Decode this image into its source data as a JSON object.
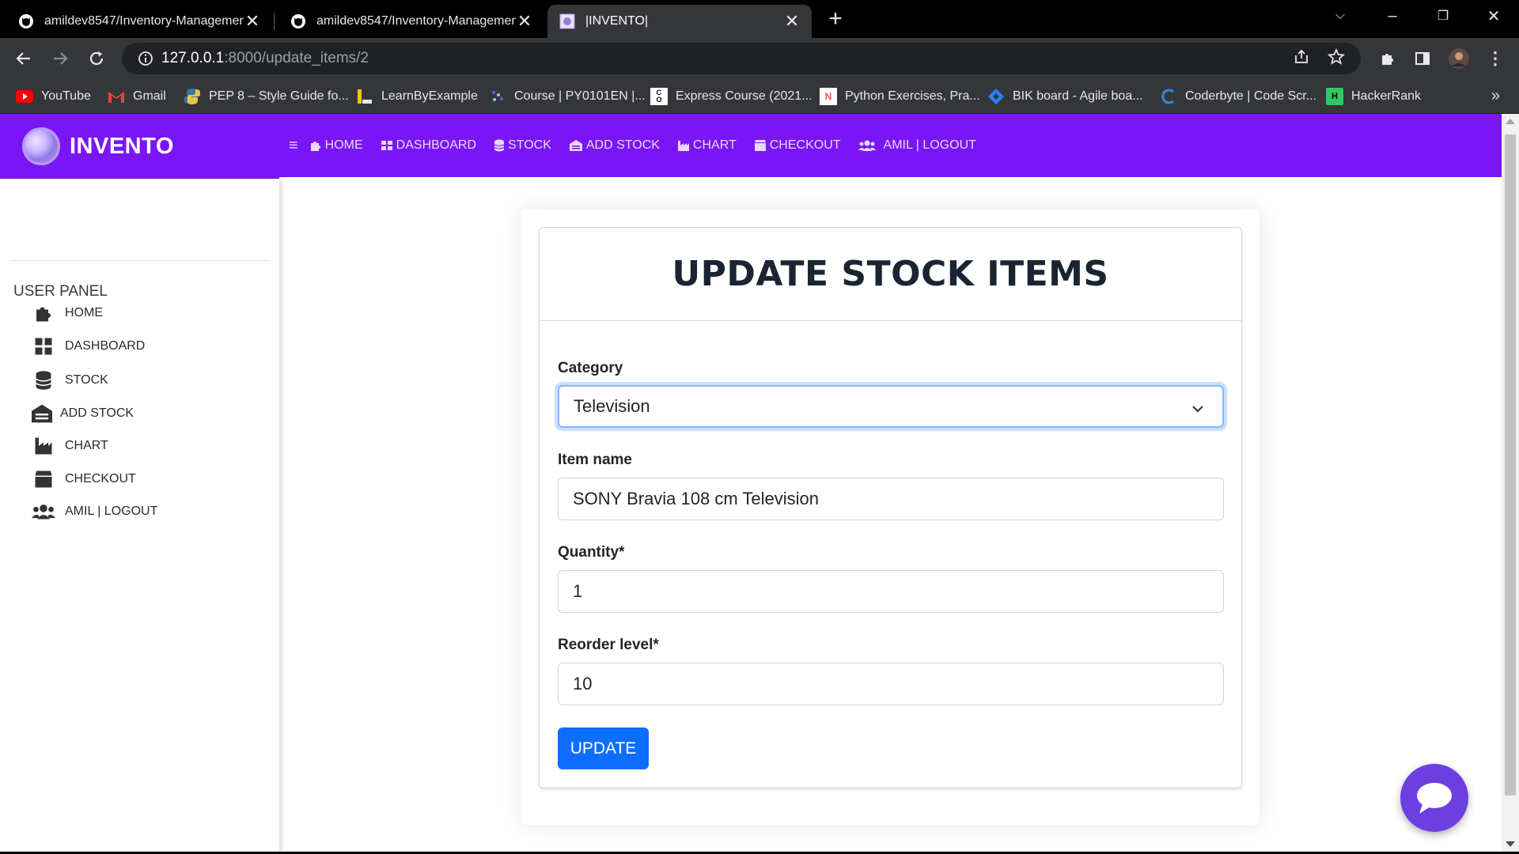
{
  "browser": {
    "tabs": [
      {
        "title": "amildev8547/Inventory-Managemen",
        "icon": "github-icon",
        "active": false
      },
      {
        "title": "amildev8547/Inventory-Managemen",
        "icon": "github-icon",
        "active": false
      },
      {
        "title": "|INVENTO|",
        "icon": "invento-favicon",
        "active": true
      }
    ],
    "url_host": "127.0.0.1",
    "url_path": ":8000/update_items/2",
    "bookmarks": [
      {
        "label": "YouTube",
        "icon": "youtube-icon",
        "color": "#ff0000"
      },
      {
        "label": "Gmail",
        "icon": "gmail-icon",
        "color": "#ea4335"
      },
      {
        "label": "PEP 8 – Style Guide fo...",
        "icon": "python-icon",
        "color": "#3776ab"
      },
      {
        "label": "LearnByExample",
        "icon": "learnbyexample-icon",
        "color": "#f4c20d"
      },
      {
        "label": "Course | PY0101EN |...",
        "icon": "course-icon",
        "color": "#4a6cf7"
      },
      {
        "label": "Express Course (2021...",
        "icon": "express-icon",
        "color": "#ffffff"
      },
      {
        "label": "Python Exercises, Pra...",
        "icon": "pynative-icon",
        "color": "#ff4f4f"
      },
      {
        "label": "BIK board - Agile boa...",
        "icon": "jira-icon",
        "color": "#2684ff"
      },
      {
        "label": "Coderbyte | Code Scr...",
        "icon": "coderbyte-icon",
        "color": "#2d8ae5"
      },
      {
        "label": "HackerRank",
        "icon": "hackerrank-icon",
        "color": "#2ec866"
      }
    ]
  },
  "app": {
    "brand": "INVENTO",
    "topnav": [
      {
        "label": "HOME",
        "icon": "puzzle-icon"
      },
      {
        "label": "DASHBOARD",
        "icon": "dashboard-icon"
      },
      {
        "label": "STOCK",
        "icon": "database-icon"
      },
      {
        "label": "ADD STOCK",
        "icon": "warehouse-icon"
      },
      {
        "label": "CHART",
        "icon": "industry-icon"
      },
      {
        "label": "CHECKOUT",
        "icon": "box-icon"
      },
      {
        "label": "AMIL | LOGOUT",
        "icon": "users-icon"
      }
    ],
    "sidebar": {
      "title": "USER PANEL",
      "items": [
        {
          "label": "HOME",
          "icon": "puzzle-icon"
        },
        {
          "label": "DASHBOARD",
          "icon": "dashboard-icon"
        },
        {
          "label": "STOCK",
          "icon": "database-icon"
        },
        {
          "label": "ADD STOCK",
          "icon": "warehouse-icon"
        },
        {
          "label": "CHART",
          "icon": "industry-icon"
        },
        {
          "label": "CHECKOUT",
          "icon": "box-icon"
        },
        {
          "label": "AMIL | LOGOUT",
          "icon": "users-icon"
        }
      ]
    },
    "form": {
      "title": "UPDATE STOCK ITEMS",
      "category_label": "Category",
      "category_value": "Television",
      "item_name_label": "Item name",
      "item_name_value": "SONY Bravia 108 cm Television",
      "quantity_label": "Quantity*",
      "quantity_value": "1",
      "reorder_label": "Reorder level*",
      "reorder_value": "10",
      "submit_label": "UPDATE"
    },
    "colors": {
      "accent": "#7a16f5",
      "button": "#0d6efd",
      "chat": "#6d3fe0"
    }
  }
}
